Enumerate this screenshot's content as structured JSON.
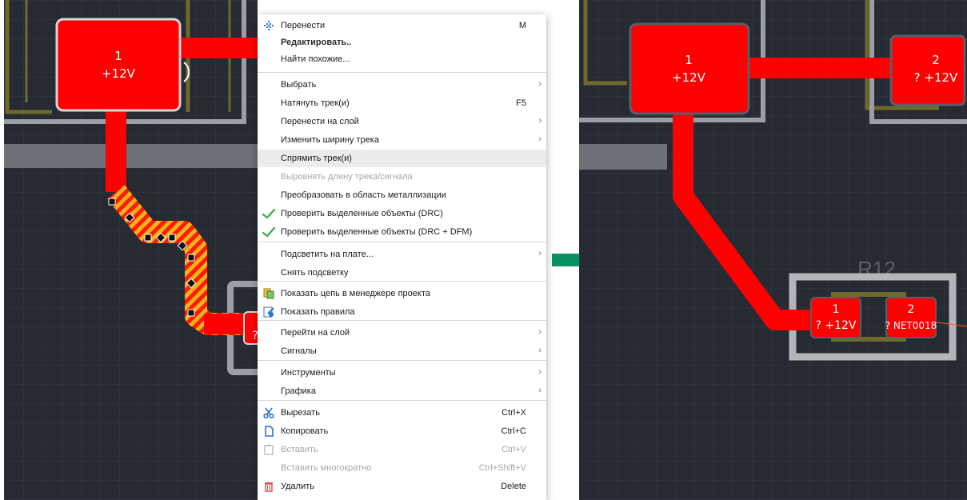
{
  "left_panel": {
    "pad1": {
      "number": "1",
      "net": "+12V"
    },
    "pad2_partial": {
      "text": "?"
    }
  },
  "right_panel": {
    "pad1": {
      "number": "1",
      "net": "+12V"
    },
    "pad2": {
      "number": "2",
      "net": "? +12V"
    },
    "component": {
      "designator": "R12",
      "pad1": {
        "number": "1",
        "net": "? +12V"
      },
      "pad2": {
        "number": "2",
        "net": "? NET0018"
      }
    }
  },
  "context_menu": {
    "items": [
      {
        "label": "Перенести",
        "shortcut": "M",
        "icon": "move-icon"
      },
      {
        "label": "Редактировать..",
        "bold": true
      },
      {
        "label": "Найти похожие..."
      },
      {
        "label": "Выбрать",
        "submenu": true
      },
      {
        "label": "Натянуть трек(и)",
        "shortcut": "F5"
      },
      {
        "label": "Перенести на слой",
        "submenu": true
      },
      {
        "label": "Изменить ширину трека",
        "submenu": true
      },
      {
        "label": "Спрямить трек(и)",
        "highlighted": true
      },
      {
        "label": "Выровнять длину трека/сигнала",
        "disabled": true
      },
      {
        "label": "Преобразовать в область металлизации"
      },
      {
        "label": "Проверить выделенные объекты (DRC)",
        "icon": "check-icon"
      },
      {
        "label": "Проверить выделенные объекты (DRC + DFM)",
        "icon": "check-icon"
      },
      {
        "label": "Подсветить на плате...",
        "submenu": true
      },
      {
        "label": "Снять подсветку"
      },
      {
        "label": "Показать цепь в менеджере проекта",
        "icon": "project-manager-icon"
      },
      {
        "label": "Показать правила",
        "icon": "rules-icon"
      },
      {
        "label": "Перейти на слой",
        "submenu": true
      },
      {
        "label": "Сигналы",
        "submenu": true
      },
      {
        "label": "Инструменты",
        "submenu": true
      },
      {
        "label": "Графика",
        "submenu": true
      },
      {
        "label": "Вырезать",
        "shortcut": "Ctrl+X",
        "icon": "scissors-icon"
      },
      {
        "label": "Копировать",
        "shortcut": "Ctrl+C",
        "icon": "copy-icon"
      },
      {
        "label": "Вставить",
        "shortcut": "Ctrl+V",
        "icon": "paste-icon",
        "disabled": true
      },
      {
        "label": "Вставить многократно",
        "shortcut": "Ctrl+Shift+V",
        "disabled": true
      },
      {
        "label": "Удалить",
        "shortcut": "Delete",
        "icon": "trash-icon"
      }
    ]
  },
  "colors": {
    "board_bg": "#262a33",
    "copper_red": "#ff0000",
    "silk_gray": "#b3b5b8",
    "keepout_olive": "#6f6a2c",
    "arrow_green": "#0a8f63"
  }
}
